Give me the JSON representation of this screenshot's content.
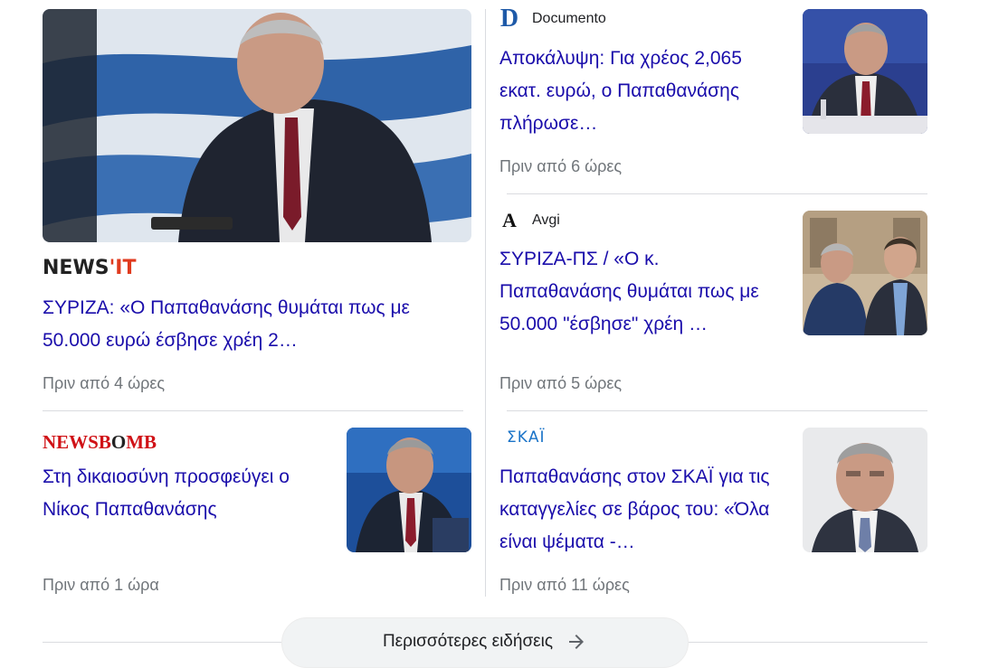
{
  "articles": [
    {
      "source": "NEWS'IT",
      "source_parts": [
        "NEWS",
        "'IT"
      ],
      "headline": "ΣΥΡΙΖΑ: «Ο Παπαθανάσης θυμάται πως με 50.000 ευρώ έσβησε χρέη 2…",
      "time": "Πριν από 4 ώρες"
    },
    {
      "source": "Documento",
      "headline": "Αποκάλυψη: Για χρέος 2,065 εκατ. ευρώ, ο Παπαθανάσης πλήρωσε…",
      "time": "Πριν από 6 ώρες"
    },
    {
      "source": "Avgi",
      "headline": "ΣΥΡΙΖΑ-ΠΣ / «Ο κ. Παπαθανάσης θυμάται πως με 50.000 \"έσβησε\" χρέη …",
      "time": "Πριν από 5 ώρες"
    },
    {
      "source": "NEWSBOMB",
      "source_parts": [
        "NEWSB",
        "O",
        "MB"
      ],
      "headline": "Στη δικαιοσύνη προσφεύγει ο Νίκος Παπαθανάσης",
      "time": "Πριν από 1 ώρα"
    },
    {
      "source": "ΣΚΑΪ",
      "headline": "Παπαθανάσης στον ΣΚΑΪ για τις καταγγελίες σε βάρος του: «Όλα είναι ψέματα -…",
      "time": "Πριν από 11 ώρες"
    }
  ],
  "more_button": {
    "label": "Περισσότερες ειδήσεις",
    "icon": "arrow-right-icon"
  },
  "colors": {
    "link": "#1a0dab",
    "meta": "#70757a",
    "divider": "#dadce0",
    "button_bg": "#f1f3f4"
  }
}
